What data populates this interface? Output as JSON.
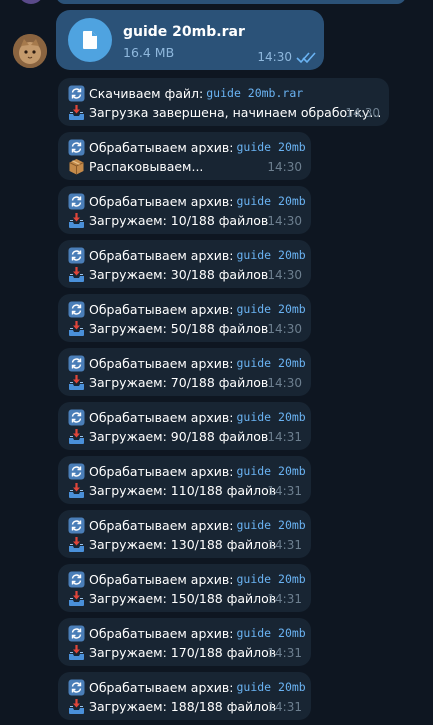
{
  "file_message": {
    "file_name": "guide 20mb.rar",
    "file_size": "16.4 MB",
    "time": "14:30"
  },
  "messages": [
    {
      "line1_label": "Скачиваем файл:",
      "line1_name": "guide 20mb.rar",
      "line2": "Загрузка завершена, начинаем обработку...",
      "line2_icon": "inbox-tray-icon",
      "time": "14:30"
    },
    {
      "line1_label": "Обрабатываем архив:",
      "line1_name": "guide 20mb",
      "line2": "Распаковываем...",
      "line2_icon": "package-icon",
      "time": "14:30"
    },
    {
      "line1_label": "Обрабатываем архив:",
      "line1_name": "guide 20mb",
      "line2": "Загружаем: 10/188 файлов",
      "line2_icon": "inbox-tray-icon",
      "time": "14:30"
    },
    {
      "line1_label": "Обрабатываем архив:",
      "line1_name": "guide 20mb",
      "line2": "Загружаем: 30/188 файлов",
      "line2_icon": "inbox-tray-icon",
      "time": "14:30"
    },
    {
      "line1_label": "Обрабатываем архив:",
      "line1_name": "guide 20mb",
      "line2": "Загружаем: 50/188 файлов",
      "line2_icon": "inbox-tray-icon",
      "time": "14:30"
    },
    {
      "line1_label": "Обрабатываем архив:",
      "line1_name": "guide 20mb",
      "line2": "Загружаем: 70/188 файлов",
      "line2_icon": "inbox-tray-icon",
      "time": "14:30"
    },
    {
      "line1_label": "Обрабатываем архив:",
      "line1_name": "guide 20mb",
      "line2": "Загружаем: 90/188 файлов",
      "line2_icon": "inbox-tray-icon",
      "time": "14:31"
    },
    {
      "line1_label": "Обрабатываем архив:",
      "line1_name": "guide 20mb",
      "line2": "Загружаем: 110/188 файлов",
      "line2_icon": "inbox-tray-icon",
      "time": "14:31"
    },
    {
      "line1_label": "Обрабатываем архив:",
      "line1_name": "guide 20mb",
      "line2": "Загружаем: 130/188 файлов",
      "line2_icon": "inbox-tray-icon",
      "time": "14:31"
    },
    {
      "line1_label": "Обрабатываем архив:",
      "line1_name": "guide 20mb",
      "line2": "Загружаем: 150/188 файлов",
      "line2_icon": "inbox-tray-icon",
      "time": "14:31"
    },
    {
      "line1_label": "Обрабатываем архив:",
      "line1_name": "guide 20mb",
      "line2": "Загружаем: 170/188 файлов",
      "line2_icon": "inbox-tray-icon",
      "time": "14:31"
    },
    {
      "line1_label": "Обрабатываем архив:",
      "line1_name": "guide 20mb",
      "line2": "Загружаем: 188/188 файлов",
      "line2_icon": "inbox-tray-icon",
      "time": "14:31"
    }
  ],
  "colors": {
    "background": "#0e1621",
    "outgoing_bubble": "#2b5278",
    "incoming_bubble": "#182533",
    "link": "#6ab3f3"
  }
}
